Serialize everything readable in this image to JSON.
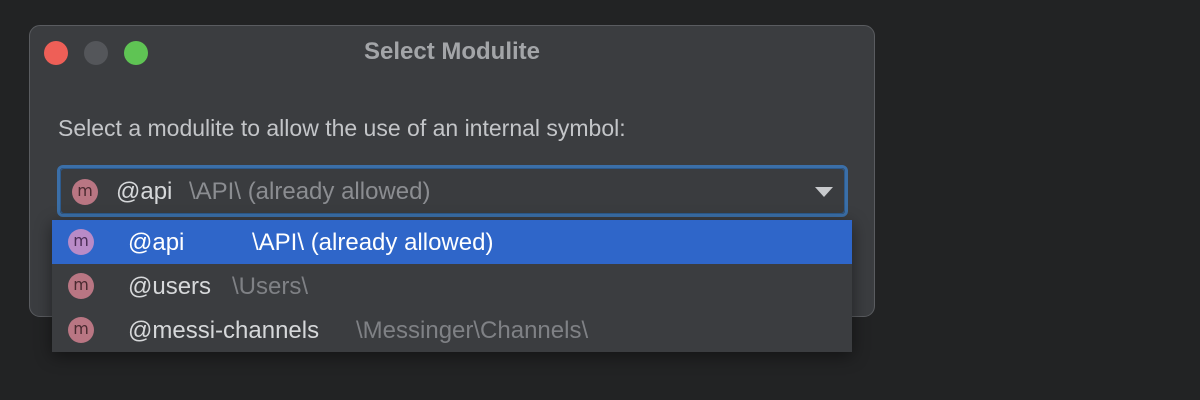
{
  "dialog": {
    "title": "Select Modulite",
    "prompt": "Select a modulite to allow the use of an internal symbol:"
  },
  "combo": {
    "icon": "modulite-icon",
    "icon_letter": "m",
    "name": "@api",
    "path": "\\API\\ (already allowed)"
  },
  "options": [
    {
      "icon_letter": "m",
      "name": "@api",
      "path": "\\API\\ (already allowed)",
      "selected": true
    },
    {
      "icon_letter": "m",
      "name": "@users",
      "path": "\\Users\\",
      "selected": false
    },
    {
      "icon_letter": "m",
      "name": "@messi-channels",
      "path": "\\Messinger\\Channels\\",
      "selected": false
    }
  ],
  "colors": {
    "selection": "#2f66c9",
    "focus_border": "#3b6fa8",
    "close": "#ee5f57",
    "maximize": "#5fc454"
  }
}
